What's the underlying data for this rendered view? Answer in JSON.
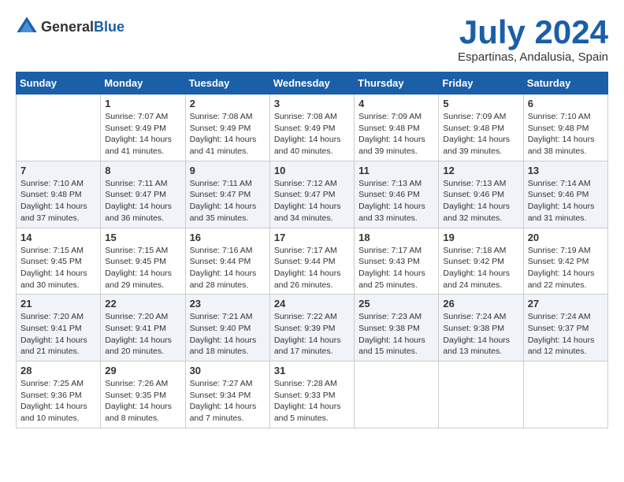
{
  "header": {
    "logo_general": "General",
    "logo_blue": "Blue",
    "month_title": "July 2024",
    "location": "Espartinas, Andalusia, Spain"
  },
  "calendar": {
    "days_of_week": [
      "Sunday",
      "Monday",
      "Tuesday",
      "Wednesday",
      "Thursday",
      "Friday",
      "Saturday"
    ],
    "weeks": [
      [
        {
          "day": "",
          "info": ""
        },
        {
          "day": "1",
          "info": "Sunrise: 7:07 AM\nSunset: 9:49 PM\nDaylight: 14 hours\nand 41 minutes."
        },
        {
          "day": "2",
          "info": "Sunrise: 7:08 AM\nSunset: 9:49 PM\nDaylight: 14 hours\nand 41 minutes."
        },
        {
          "day": "3",
          "info": "Sunrise: 7:08 AM\nSunset: 9:49 PM\nDaylight: 14 hours\nand 40 minutes."
        },
        {
          "day": "4",
          "info": "Sunrise: 7:09 AM\nSunset: 9:48 PM\nDaylight: 14 hours\nand 39 minutes."
        },
        {
          "day": "5",
          "info": "Sunrise: 7:09 AM\nSunset: 9:48 PM\nDaylight: 14 hours\nand 39 minutes."
        },
        {
          "day": "6",
          "info": "Sunrise: 7:10 AM\nSunset: 9:48 PM\nDaylight: 14 hours\nand 38 minutes."
        }
      ],
      [
        {
          "day": "7",
          "info": "Sunrise: 7:10 AM\nSunset: 9:48 PM\nDaylight: 14 hours\nand 37 minutes."
        },
        {
          "day": "8",
          "info": "Sunrise: 7:11 AM\nSunset: 9:47 PM\nDaylight: 14 hours\nand 36 minutes."
        },
        {
          "day": "9",
          "info": "Sunrise: 7:11 AM\nSunset: 9:47 PM\nDaylight: 14 hours\nand 35 minutes."
        },
        {
          "day": "10",
          "info": "Sunrise: 7:12 AM\nSunset: 9:47 PM\nDaylight: 14 hours\nand 34 minutes."
        },
        {
          "day": "11",
          "info": "Sunrise: 7:13 AM\nSunset: 9:46 PM\nDaylight: 14 hours\nand 33 minutes."
        },
        {
          "day": "12",
          "info": "Sunrise: 7:13 AM\nSunset: 9:46 PM\nDaylight: 14 hours\nand 32 minutes."
        },
        {
          "day": "13",
          "info": "Sunrise: 7:14 AM\nSunset: 9:46 PM\nDaylight: 14 hours\nand 31 minutes."
        }
      ],
      [
        {
          "day": "14",
          "info": "Sunrise: 7:15 AM\nSunset: 9:45 PM\nDaylight: 14 hours\nand 30 minutes."
        },
        {
          "day": "15",
          "info": "Sunrise: 7:15 AM\nSunset: 9:45 PM\nDaylight: 14 hours\nand 29 minutes."
        },
        {
          "day": "16",
          "info": "Sunrise: 7:16 AM\nSunset: 9:44 PM\nDaylight: 14 hours\nand 28 minutes."
        },
        {
          "day": "17",
          "info": "Sunrise: 7:17 AM\nSunset: 9:44 PM\nDaylight: 14 hours\nand 26 minutes."
        },
        {
          "day": "18",
          "info": "Sunrise: 7:17 AM\nSunset: 9:43 PM\nDaylight: 14 hours\nand 25 minutes."
        },
        {
          "day": "19",
          "info": "Sunrise: 7:18 AM\nSunset: 9:42 PM\nDaylight: 14 hours\nand 24 minutes."
        },
        {
          "day": "20",
          "info": "Sunrise: 7:19 AM\nSunset: 9:42 PM\nDaylight: 14 hours\nand 22 minutes."
        }
      ],
      [
        {
          "day": "21",
          "info": "Sunrise: 7:20 AM\nSunset: 9:41 PM\nDaylight: 14 hours\nand 21 minutes."
        },
        {
          "day": "22",
          "info": "Sunrise: 7:20 AM\nSunset: 9:41 PM\nDaylight: 14 hours\nand 20 minutes."
        },
        {
          "day": "23",
          "info": "Sunrise: 7:21 AM\nSunset: 9:40 PM\nDaylight: 14 hours\nand 18 minutes."
        },
        {
          "day": "24",
          "info": "Sunrise: 7:22 AM\nSunset: 9:39 PM\nDaylight: 14 hours\nand 17 minutes."
        },
        {
          "day": "25",
          "info": "Sunrise: 7:23 AM\nSunset: 9:38 PM\nDaylight: 14 hours\nand 15 minutes."
        },
        {
          "day": "26",
          "info": "Sunrise: 7:24 AM\nSunset: 9:38 PM\nDaylight: 14 hours\nand 13 minutes."
        },
        {
          "day": "27",
          "info": "Sunrise: 7:24 AM\nSunset: 9:37 PM\nDaylight: 14 hours\nand 12 minutes."
        }
      ],
      [
        {
          "day": "28",
          "info": "Sunrise: 7:25 AM\nSunset: 9:36 PM\nDaylight: 14 hours\nand 10 minutes."
        },
        {
          "day": "29",
          "info": "Sunrise: 7:26 AM\nSunset: 9:35 PM\nDaylight: 14 hours\nand 8 minutes."
        },
        {
          "day": "30",
          "info": "Sunrise: 7:27 AM\nSunset: 9:34 PM\nDaylight: 14 hours\nand 7 minutes."
        },
        {
          "day": "31",
          "info": "Sunrise: 7:28 AM\nSunset: 9:33 PM\nDaylight: 14 hours\nand 5 minutes."
        },
        {
          "day": "",
          "info": ""
        },
        {
          "day": "",
          "info": ""
        },
        {
          "day": "",
          "info": ""
        }
      ]
    ]
  }
}
